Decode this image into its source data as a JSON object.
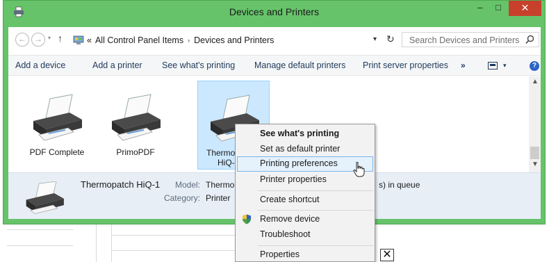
{
  "window": {
    "title": "Devices and Printers",
    "minimize_glyph": "–",
    "maximize_glyph": "□",
    "close_glyph": "✕"
  },
  "address_bar": {
    "back_glyph": "←",
    "forward_glyph": "→",
    "dropdown_glyph": "▾",
    "up_glyph": "↑",
    "overflow_glyph": "«",
    "crumbs": [
      "All Control Panel Items",
      "Devices and Printers"
    ],
    "separator_glyph": "›",
    "refresh_glyph": "↻",
    "search_placeholder": "Search Devices and Printers"
  },
  "command_bar": {
    "items": [
      "Add a device",
      "Add a printer",
      "See what's printing",
      "Manage default printers",
      "Print server properties"
    ],
    "more_glyph": "»",
    "help_glyph": "?"
  },
  "devices": [
    {
      "name": "PDF Complete",
      "selected": false
    },
    {
      "name": "PrimoPDF",
      "selected": false
    },
    {
      "name_line1": "Thermo",
      "name_line2": "HiQ-",
      "selected": true
    }
  ],
  "details": {
    "name": "Thermopatch HiQ-1",
    "model_label": "Model:",
    "model_value": "Thermop",
    "category_label": "Category:",
    "category_value": "Printer",
    "status_fragment": "s) in queue"
  },
  "context_menu": {
    "items": [
      {
        "label": "See what's printing",
        "bold": true
      },
      {
        "label": "Set as default printer"
      },
      {
        "label": "Printing preferences",
        "hover": true
      },
      {
        "label": "Printer properties"
      },
      {
        "label": "Create shortcut"
      },
      {
        "label": "Remove device",
        "icon": "shield-icon"
      },
      {
        "label": "Troubleshoot"
      },
      {
        "label": "Properties"
      }
    ]
  },
  "background_app": {
    "close_box_glyph": "✕"
  },
  "colors": {
    "window_frame": "#66c36a",
    "close_button": "#c7402c",
    "selection": "#cce8ff",
    "details_pane": "#e7eef6",
    "command_text": "#1e395b"
  }
}
